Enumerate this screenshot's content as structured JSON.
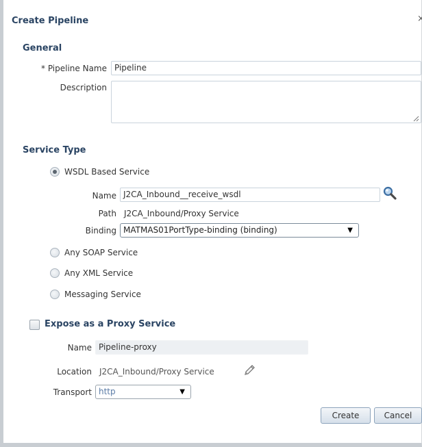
{
  "dialog": {
    "title": "Create Pipeline",
    "close_label": "×"
  },
  "general": {
    "heading": "General",
    "pipeline_name_label": "* Pipeline Name",
    "pipeline_name_value": "Pipeline",
    "description_label": "Description",
    "description_value": ""
  },
  "service_type": {
    "heading": "Service Type",
    "wsdl_option": "WSDL Based Service",
    "name_label": "Name",
    "name_value": "J2CA_Inbound__receive_wsdl",
    "path_label": "Path",
    "path_value": "J2CA_Inbound/Proxy Service",
    "binding_label": "Binding",
    "binding_value": "MATMAS01PortType-binding (binding)",
    "soap_option": "Any SOAP Service",
    "xml_option": "Any XML Service",
    "messaging_option": "Messaging Service",
    "selected": "WSDL Based Service"
  },
  "proxy": {
    "checkbox_label": "Expose as a Proxy Service",
    "checked": false,
    "name_label": "Name",
    "name_value": "Pipeline-proxy",
    "location_label": "Location",
    "location_value": "J2CA_Inbound/Proxy Service",
    "transport_label": "Transport",
    "transport_value": "http"
  },
  "buttons": {
    "create": "Create",
    "cancel": "Cancel"
  },
  "icons": {
    "search": "search-icon",
    "edit": "pencil-icon"
  },
  "colors": {
    "heading": "#2a4463",
    "accent_border": "#8ca3bb"
  }
}
